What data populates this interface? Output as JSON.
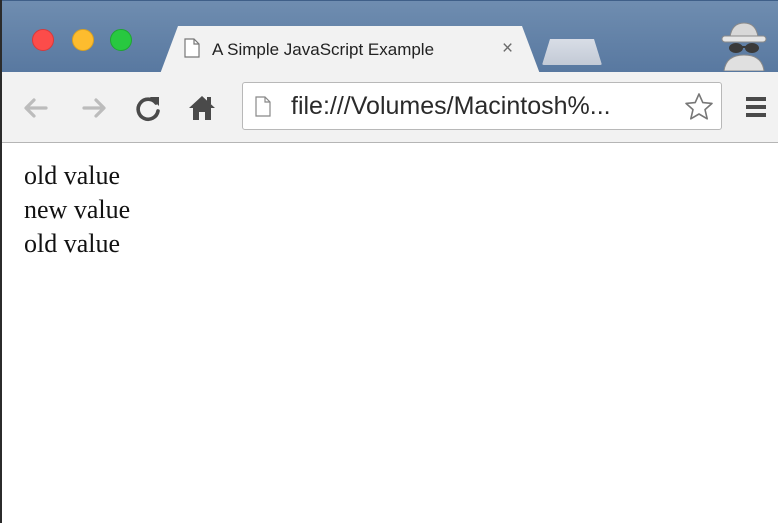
{
  "window": {
    "tab": {
      "title": "A Simple JavaScript Example",
      "close_glyph": "×"
    }
  },
  "toolbar": {
    "address_bar": {
      "url": "file:///Volumes/Macintosh%..."
    }
  },
  "page": {
    "lines": [
      "old value",
      "new value",
      "old value"
    ]
  },
  "icons": {
    "back": "arrow-left-icon",
    "forward": "arrow-right-icon",
    "reload": "reload-icon",
    "home": "home-icon",
    "star": "star-icon",
    "menu": "hamburger-menu-icon",
    "incognito": "incognito-icon",
    "page": "page-icon"
  },
  "colors": {
    "close": "#fc4c4a",
    "minimize": "#fdbc2e",
    "maximize": "#28c840",
    "tabstrip": "#5f80a8"
  }
}
